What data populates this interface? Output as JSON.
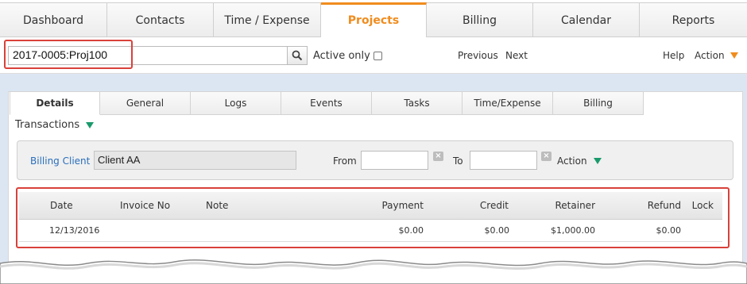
{
  "nav": {
    "tabs": [
      {
        "label": "Dashboard",
        "active": false
      },
      {
        "label": "Contacts",
        "active": false
      },
      {
        "label": "Time / Expense",
        "active": false
      },
      {
        "label": "Projects",
        "active": true
      },
      {
        "label": "Billing",
        "active": false
      },
      {
        "label": "Calendar",
        "active": false
      },
      {
        "label": "Reports",
        "active": false
      }
    ]
  },
  "search": {
    "value": "2017-0005:Proj100",
    "active_only_label": "Active only",
    "previous_label": "Previous",
    "next_label": "Next",
    "help_label": "Help",
    "action_label": "Action"
  },
  "subtabs": [
    {
      "label": "Details",
      "active": true
    },
    {
      "label": "General",
      "active": false
    },
    {
      "label": "Logs",
      "active": false
    },
    {
      "label": "Events",
      "active": false
    },
    {
      "label": "Tasks",
      "active": false
    },
    {
      "label": "Time/Expense",
      "active": false
    },
    {
      "label": "Billing",
      "active": false
    }
  ],
  "transactions": {
    "label": "Transactions"
  },
  "filter": {
    "billing_client_label": "Billing Client",
    "billing_client_value": "Client AA",
    "from_label": "From",
    "to_label": "To",
    "action_label": "Action"
  },
  "table": {
    "headers": [
      "Date",
      "Invoice No",
      "Note",
      "Payment",
      "Credit",
      "Retainer",
      "Refund",
      "Lock"
    ],
    "rows": [
      [
        "12/13/2016",
        "",
        "",
        "$0.00",
        "$0.00",
        "$1,000.00",
        "$0.00",
        ""
      ]
    ]
  },
  "colors": {
    "accent": "#f08c1e",
    "highlight": "#d9413a",
    "panel_bg": "#dce6f3",
    "link": "#2a6ebb",
    "green_arrow": "#1a9a6c"
  }
}
